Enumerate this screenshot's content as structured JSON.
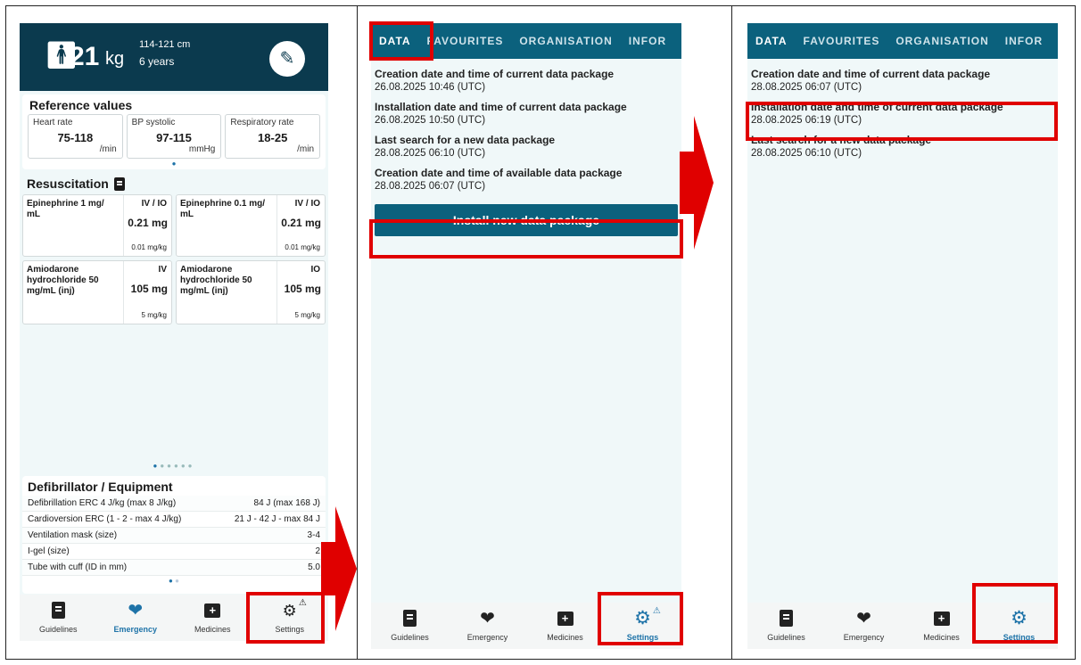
{
  "panel1": {
    "weight_value": "21",
    "weight_unit": "kg",
    "height_range": "114-121 cm",
    "age": "6 years",
    "reference": {
      "title": "Reference values",
      "items": [
        {
          "label": "Heart rate",
          "value": "75-118",
          "unit": "/min"
        },
        {
          "label": "BP systolic",
          "value": "97-115",
          "unit": "mmHg"
        },
        {
          "label": "Respiratory rate",
          "value": "18-25",
          "unit": "/min"
        }
      ]
    },
    "resuscitation": {
      "title": "Resuscitation",
      "drugs": [
        {
          "name": "Epinephrine 1 mg/ mL",
          "route": "IV / IO",
          "dose": "0.21 mg",
          "per_kg": "0.01 mg/kg"
        },
        {
          "name": "Epinephrine 0.1 mg/ mL",
          "route": "IV / IO",
          "dose": "0.21 mg",
          "per_kg": "0.01 mg/kg"
        },
        {
          "name": "Amiodarone hydrochloride 50 mg/mL (inj)",
          "route": "IV",
          "dose": "105 mg",
          "per_kg": "5 mg/kg"
        },
        {
          "name": "Amiodarone hydrochloride 50 mg/mL (inj)",
          "route": "IO",
          "dose": "105 mg",
          "per_kg": "5 mg/kg"
        }
      ]
    },
    "defibrillator": {
      "title": "Defibrillator / Equipment",
      "rows": [
        {
          "label": "Defibrillation ERC 4 J/kg (max 8 J/kg)",
          "value": "84 J (max 168 J)"
        },
        {
          "label": "Cardioversion ERC  (1 - 2 - max 4 J/kg)",
          "value": "21 J - 42 J - max 84 J"
        },
        {
          "label": "Ventilation mask (size)",
          "value": "3-4"
        },
        {
          "label": "I-gel (size)",
          "value": "2"
        },
        {
          "label": "Tube with cuff (ID in mm)",
          "value": "5.0"
        }
      ]
    }
  },
  "tabs": {
    "labels": [
      "Guidelines",
      "Emergency",
      "Medicines",
      "Settings"
    ],
    "icons": [
      "book-icon",
      "heartbeat-icon",
      "medicine-box-icon",
      "gear-icon"
    ]
  },
  "settings_tabs": [
    "DATA",
    "FAVOURITES",
    "ORGANISATION",
    "INFOR"
  ],
  "panel2": {
    "items": [
      {
        "title": "Creation date and time of current data package",
        "value": "26.08.2025 10:46 (UTC)"
      },
      {
        "title": "Installation date and time of current data package",
        "value": "26.08.2025 10:50 (UTC)"
      },
      {
        "title": "Last search for a new data package",
        "value": "28.08.2025 06:10 (UTC)"
      },
      {
        "title": "Creation date and time of available data package",
        "value": "28.08.2025 06:07 (UTC)"
      }
    ],
    "install_button": "Install new data package"
  },
  "panel3": {
    "items": [
      {
        "title": "Creation date and time of current data package",
        "value": "28.08.2025 06:07 (UTC)"
      },
      {
        "title": "Installation date and time of current data package",
        "value": "28.08.2025 06:19 (UTC)"
      },
      {
        "title": "Last search for a new data package",
        "value": "28.08.2025 06:10 (UTC)"
      }
    ]
  },
  "colors": {
    "header_dark": "#0b3a4e",
    "topbar": "#0b617d",
    "accent_blue": "#1e73a8",
    "highlight_red": "#e00000",
    "background": "#f0f8f9"
  }
}
